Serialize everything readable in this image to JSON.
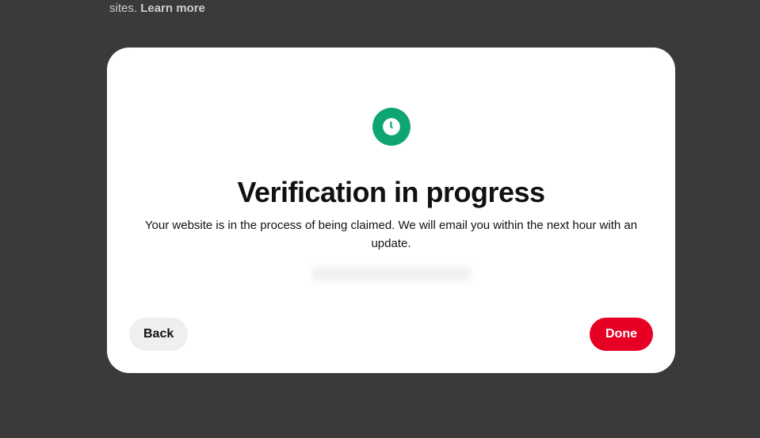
{
  "background": {
    "text_fragment": "sites.",
    "learn_more": "Learn more"
  },
  "modal": {
    "icon": "clock-icon",
    "title": "Verification in progress",
    "description": "Your website is in the process of being claimed. We will email you within the next hour with an update.",
    "buttons": {
      "back": "Back",
      "done": "Done"
    }
  }
}
